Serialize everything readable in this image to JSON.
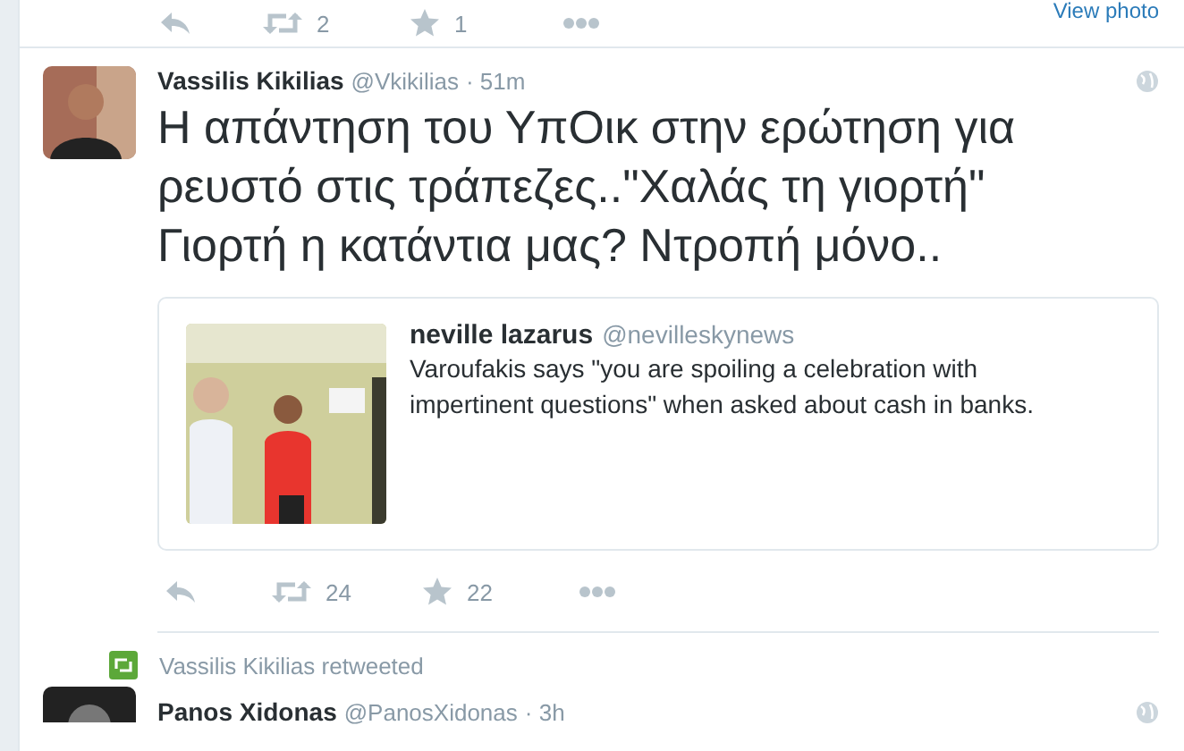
{
  "previous_tweet": {
    "retweets": "2",
    "favorites": "1",
    "view_link": "View photo"
  },
  "tweet": {
    "name": "Vassilis Kikilias",
    "handle": "@Vkikilias",
    "time": "· 51m",
    "text": "Η απάντηση του ΥπΟικ στην ερώτηση για ρευστό στις τράπεζες..\"Χαλάς τη γιορτή\" Γιορτή η κατάντια μας? Ντροπή μόνο..",
    "quote": {
      "kind": "picture",
      "name": "neville lazarus",
      "handle": "@nevilleskynews",
      "text": "Varoufakis says \"you are spoiling a celebration with impertinent questions\" when asked about cash in banks."
    },
    "retweets": "24",
    "favorites": "22"
  },
  "next_tweet": {
    "retweeted_by": "Vassilis Kikilias retweeted",
    "name": "Panos Xidonas",
    "handle": "@PanosXidonas",
    "time": "· 3h"
  }
}
